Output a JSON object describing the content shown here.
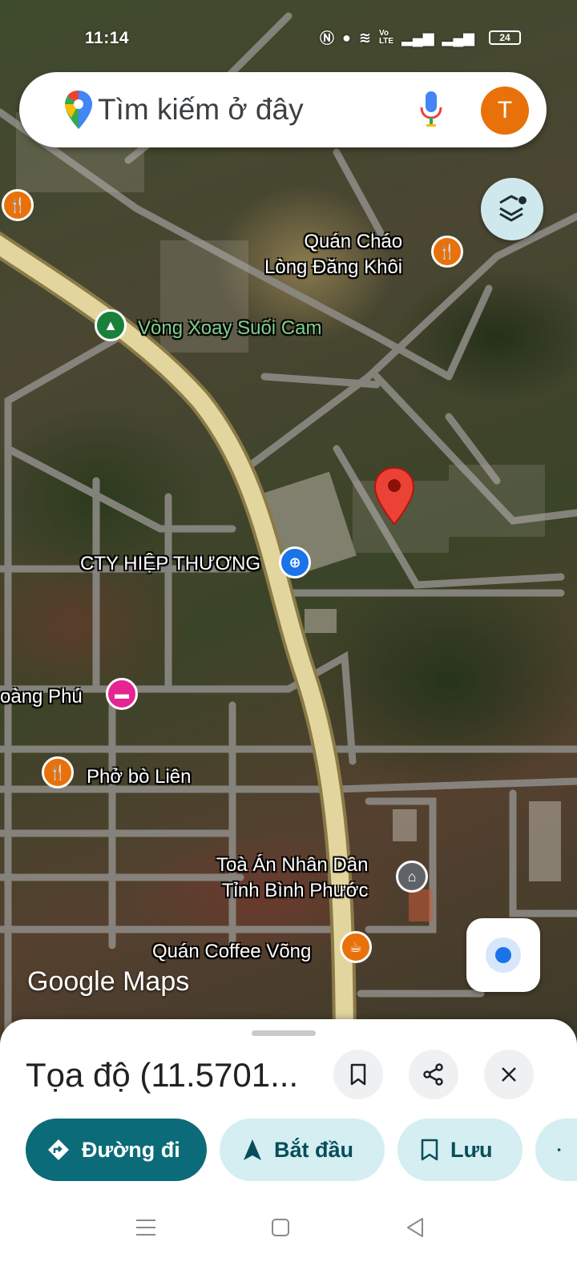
{
  "status_bar": {
    "time": "11:14",
    "icons": [
      "nfc-icon",
      "location-icon",
      "wifi-icon",
      "volte-icon",
      "signal-icon",
      "signal-icon"
    ],
    "battery": "24"
  },
  "search": {
    "placeholder": "Tìm kiếm ở đây",
    "avatar_letter": "T"
  },
  "map": {
    "pois": [
      {
        "name": "Quán Cháo\nLòng Đăng Khôi",
        "icon": "restaurant-icon",
        "color": "#e8710a"
      },
      {
        "name": "Vòng Xoay Suối Cam",
        "icon": "park-icon",
        "color": "#188038"
      },
      {
        "name": "CTY HIỆP THƯƠNG",
        "icon": "shopping-icon",
        "color": "#1a73e8"
      },
      {
        "name": "oàng Phú",
        "icon": "hotel-icon",
        "color": "#e52592"
      },
      {
        "name": "Phở bò Liên",
        "icon": "restaurant-icon",
        "color": "#e8710a"
      },
      {
        "name": "Toà Án Nhân Dân\nTỉnh Bình Phước",
        "icon": "courthouse-icon",
        "color": "#5f6368"
      },
      {
        "name": "Quán Coffee Võng",
        "icon": "cafe-icon",
        "color": "#e8710a"
      }
    ],
    "logo": "Google Maps"
  },
  "sheet": {
    "title": "Tọa độ (11.5701...",
    "actions": {
      "directions": "Đường đi",
      "start": "Bắt đầu",
      "save": "Lưu"
    }
  },
  "colors": {
    "primary": "#0b6b78",
    "tonal": "#d4eef2",
    "avatar": "#e8710a",
    "pin": "#ea4335"
  }
}
